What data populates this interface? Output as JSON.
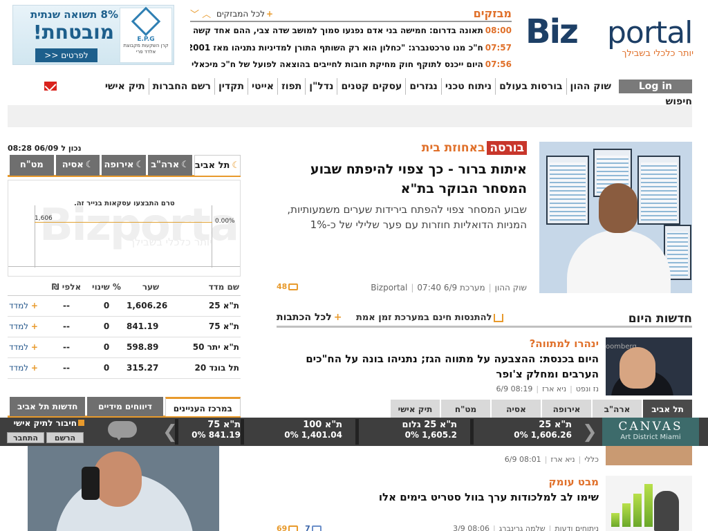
{
  "header": {
    "logo_biz": "Biz",
    "logo_portal": "portal",
    "logo_tagline": "יותר כלכלי בשבילך",
    "ticker_title": "מבזקים",
    "ticker_all": "לכל המבזקים",
    "ticker": [
      {
        "time": "08:00",
        "text": "תאונה בדרום: חמישה בני אדם נפגעו סמוך למושב שדה צבי, ההם אחד קשה"
      },
      {
        "time": "07:57",
        "text": "ח\"כ מנו טרכטנברג: \"כחלון הוא רק השותף התורן למדיניות נתניהו מאז 2001\""
      },
      {
        "time": "07:56",
        "text": "היום ייכנס לתוקף חוק מחיקת חובות לחייבים בהוצאה לפועל של ח\"כ מיכאלי"
      }
    ]
  },
  "ad_top": {
    "line1": "8% תשואה שנתית",
    "line2": "מובטחת!",
    "cta": "לפרטים <<",
    "brand": "E.P.G",
    "brand_sub": "קרן השקעות מקבוצת אלדד פרי"
  },
  "nav": {
    "login": "Log in",
    "items": [
      "שוק ההון",
      "בורסות בעולם",
      "ניתוח טכני",
      "נגזרים",
      "עסקים קטנים",
      "נדל\"ן",
      "תפוז",
      "אייטי",
      "תקדין",
      "רשם החברות",
      "תיק אישי"
    ],
    "search": "חיפוש"
  },
  "lead": {
    "tag": "בורסה",
    "kicker": "באחוזת בית",
    "title": "איתות ברור - כך צפוי להיפתח שבוע המסחר הבוקר בת\"א",
    "summary": "שבוע המסחר צפוי להפתח בירידות שערים משמעותיות, המניות הדואליות חוזרות עם פער שלילי של כ-1%",
    "section": "שוק ההון",
    "author": "מערכת Bizportal",
    "datetime": "07:40 6/9",
    "comments": "48"
  },
  "news": {
    "title": "חדשות היום",
    "realtime": "להתנסות חינם במערכת זמן אמת",
    "all": "לכל הכתבות",
    "items": [
      {
        "kicker": "ינהרו למתווה?",
        "title": "היום בכנסת: ההצבעה על מתווה הגז; נתניהו בונה על הח\"כים הערבים ומחלק צ'ופר",
        "section": "נז ונפט",
        "author": "ניא ארז",
        "datetime": "08:19 6/9"
      },
      {
        "kicker": "",
        "title": "",
        "section": "כללי",
        "author": "ניא ארז",
        "datetime": "08:01 6/9"
      },
      {
        "kicker": "מבט עומק",
        "title": "שימו לב למלכודות ערך בוול סטריט בימים אלו",
        "section": "ניתוחים ודעות",
        "author": "שלמה גרינברג",
        "datetime": "08:06 3/9",
        "comments": "69",
        "likes": "7"
      }
    ]
  },
  "market_tabs": [
    "תל אביב",
    "ארה\"ב",
    "אירופה",
    "אסיה",
    "מט\"ח",
    "תיק אישי"
  ],
  "indices": {
    "updated": "נכון ל 06/09 08:28",
    "tabs": [
      "תל אביב",
      "ארה\"ב",
      "אירופה",
      "אסיה",
      "מט\"ח"
    ],
    "chart_msg": "טרם התבצעו עסקאות בנייר זה.",
    "chart_value": "1,606",
    "chart_pct": "0.00%",
    "watermark": "Bizportal",
    "watermark_tag": "יותר כלכלי בשבילך",
    "columns": [
      "שם מדד",
      "שער",
      "% שינוי",
      "אלפי ₪"
    ],
    "learn_label": "למדד",
    "rows": [
      {
        "name": "ת\"א 25",
        "rate": "1,606.26",
        "change": "0",
        "volume": "--"
      },
      {
        "name": "ת\"א 75",
        "rate": "841.19",
        "change": "0",
        "volume": "--"
      },
      {
        "name": "ת\"א יתר 50",
        "rate": "598.89",
        "change": "0",
        "volume": "--"
      },
      {
        "name": "תל בונד 20",
        "rate": "315.27",
        "change": "0",
        "volume": "--"
      }
    ]
  },
  "bottom_tabs": [
    "במרכז העניינים",
    "דיווחים מידיים",
    "חדשות תל אביב"
  ],
  "sticky": {
    "canvas_title": "CANVAS",
    "canvas_sub": "Art District Miami",
    "quotes": [
      {
        "name": "ת\"א 25",
        "value": "1,606.26 0%"
      },
      {
        "name": "ת\"א 25 גלום",
        "value": "1,605.2 0%"
      },
      {
        "name": "ת\"א 100",
        "value": "1,401.04 0%"
      },
      {
        "name": "ת\"א 75",
        "value": "841.19 0%"
      }
    ],
    "portfolio": "חיבור לתיק אישי",
    "register": "הרשם",
    "login": "התחבר"
  }
}
